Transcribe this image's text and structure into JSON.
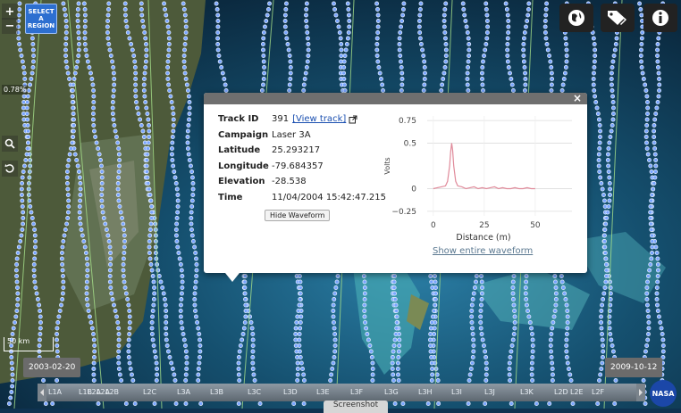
{
  "map_controls": {
    "zoom_in": "+",
    "zoom_out": "−",
    "select_region": "SELECT A REGION",
    "percent": "0.78%",
    "scale_label": "50 km"
  },
  "top_right_buttons": [
    "globe-icon",
    "tags-icon",
    "info-icon"
  ],
  "popup": {
    "close": "×",
    "fields": [
      {
        "key": "Track ID",
        "value": "391"
      },
      {
        "key": "Campaign",
        "value": "Laser 3A"
      },
      {
        "key": "Latitude",
        "value": "25.293217"
      },
      {
        "key": "Longitude",
        "value": "-79.684357"
      },
      {
        "key": "Elevation",
        "value": "-28.538"
      },
      {
        "key": "Time",
        "value": "11/04/2004 15:42:47.215"
      }
    ],
    "view_track": "[View track]",
    "hide_waveform": "Hide Waveform",
    "show_entire_waveform": "Show entire waveform"
  },
  "chart_data": {
    "type": "line",
    "xlabel": "Distance (m)",
    "ylabel": "Volts",
    "xlim": [
      -3,
      68
    ],
    "ylim": [
      -0.3,
      0.8
    ],
    "x_ticks": [
      "0",
      "25",
      "50"
    ],
    "y_ticks": [
      "0.75",
      "0.5",
      "0",
      "−0.25"
    ],
    "series": [
      {
        "color": "#e08a9a",
        "x": [
          0,
          2,
          4,
          6,
          7,
          8,
          8.5,
          9,
          9.5,
          10,
          11,
          12,
          14,
          16,
          18,
          20,
          22,
          24,
          26,
          28,
          30,
          32,
          34,
          36,
          38,
          40,
          42,
          44,
          46,
          48,
          50
        ],
        "y": [
          0.0,
          0.01,
          0.02,
          0.03,
          0.08,
          0.25,
          0.4,
          0.5,
          0.42,
          0.25,
          0.08,
          0.03,
          0.02,
          0.0,
          0.01,
          0.02,
          0.0,
          0.01,
          0.0,
          0.01,
          0.02,
          0.0,
          0.01,
          0.0,
          0.0,
          0.01,
          0.0,
          0.0,
          0.01,
          0.0,
          0.0
        ]
      }
    ]
  },
  "timeline": {
    "start_date": "2003-02-20",
    "end_date": "2009-10-12",
    "labels": [
      "L1A",
      "L1B",
      "L2A",
      "L2A",
      "L2B",
      "L2C",
      "L3A",
      "L3B",
      "L3C",
      "L3D",
      "L3E",
      "L3F",
      "L3G",
      "L3H",
      "L3I",
      "L3J",
      "L3K",
      "L2D",
      "L2E",
      "L2F"
    ]
  },
  "screenshot_label": "Screenshot",
  "nasa_label": "NASA"
}
